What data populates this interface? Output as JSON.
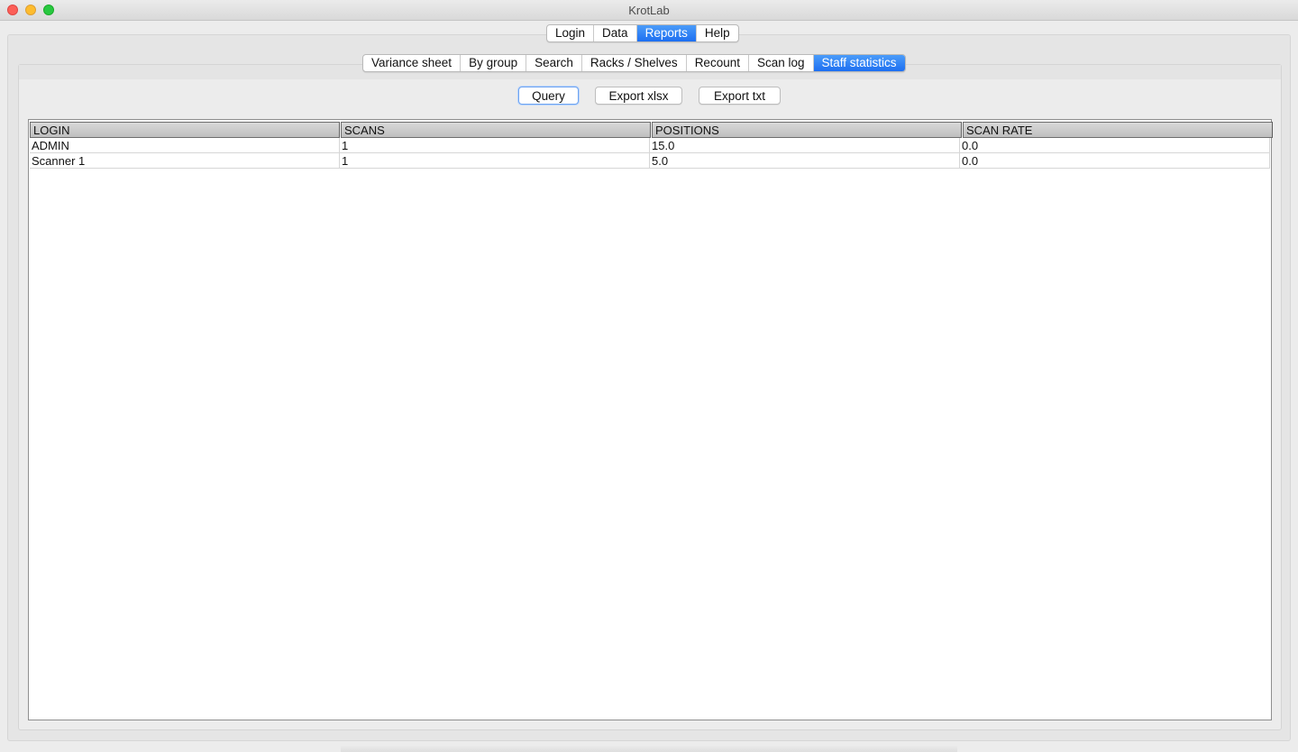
{
  "window": {
    "title": "KrotLab"
  },
  "main_tabs": [
    {
      "label": "Login",
      "active": false
    },
    {
      "label": "Data",
      "active": false
    },
    {
      "label": "Reports",
      "active": true
    },
    {
      "label": "Help",
      "active": false
    }
  ],
  "report_tabs": [
    {
      "label": "Variance sheet",
      "active": false
    },
    {
      "label": "By group",
      "active": false
    },
    {
      "label": "Search",
      "active": false
    },
    {
      "label": "Racks / Shelves",
      "active": false
    },
    {
      "label": "Recount",
      "active": false
    },
    {
      "label": "Scan log",
      "active": false
    },
    {
      "label": "Staff statistics",
      "active": true
    }
  ],
  "toolbar": {
    "query_label": "Query",
    "export_xlsx_label": "Export xlsx",
    "export_txt_label": "Export txt"
  },
  "table": {
    "columns": [
      "LOGIN",
      "SCANS",
      "POSITIONS",
      "SCAN RATE"
    ],
    "rows": [
      [
        "ADMIN",
        "1",
        "15.0",
        "0.0"
      ],
      [
        "Scanner 1",
        "1",
        "5.0",
        "0.0"
      ]
    ]
  },
  "colors": {
    "accent": "#1d6ff1",
    "window_bg": "#ececec"
  }
}
